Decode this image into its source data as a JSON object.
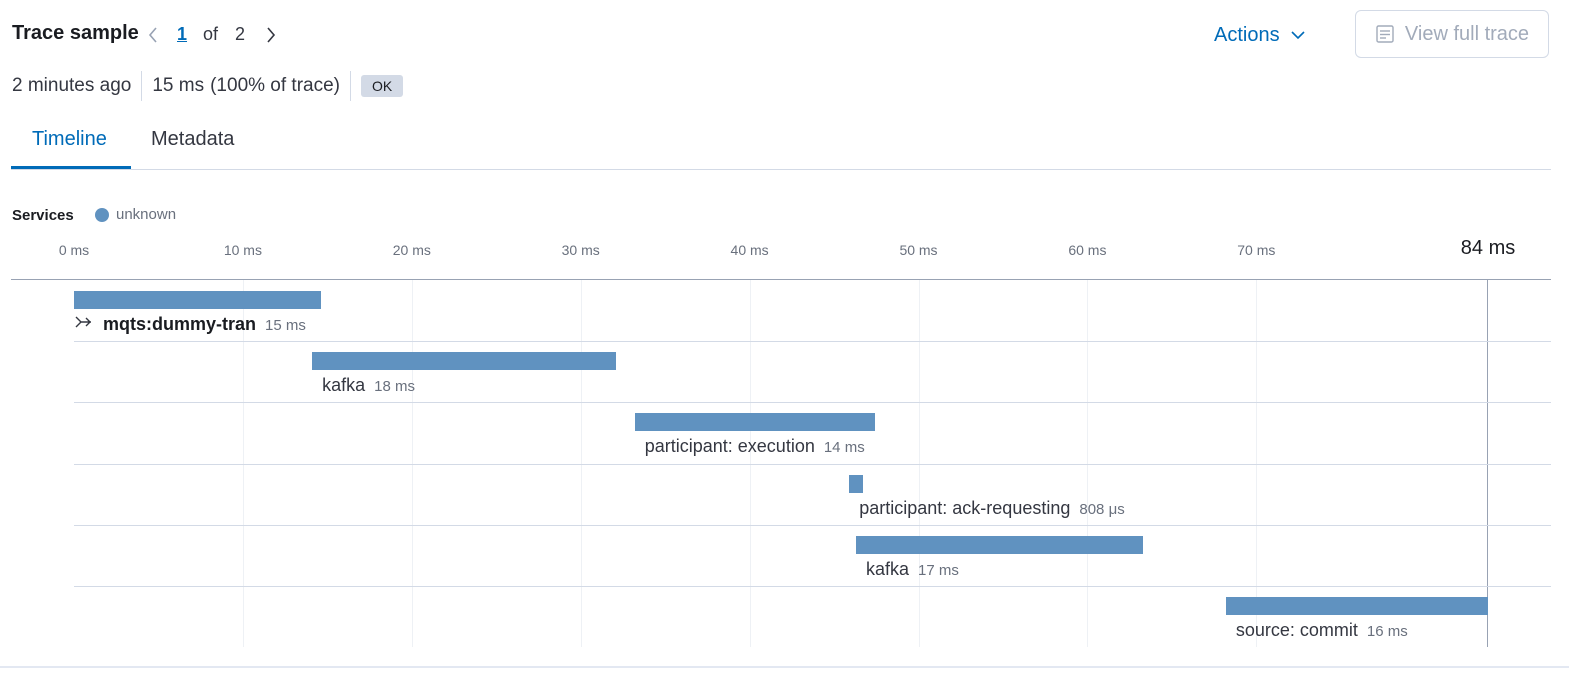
{
  "header": {
    "title": "Trace sample",
    "pager": {
      "current": "1",
      "of": "of",
      "total": "2"
    },
    "actions_label": "Actions",
    "view_full_trace_label": "View full trace"
  },
  "summary": {
    "time_ago": "2 minutes ago",
    "duration": "15 ms",
    "percent": "(100% of trace)",
    "status": "OK"
  },
  "tabs": [
    {
      "label": "Timeline",
      "active": true
    },
    {
      "label": "Metadata",
      "active": false
    }
  ],
  "legend": {
    "title": "Services",
    "items": [
      {
        "label": "unknown",
        "color": "#6092c0"
      }
    ]
  },
  "timeline": {
    "ticks": [
      "0 ms",
      "10 ms",
      "20 ms",
      "30 ms",
      "40 ms",
      "50 ms",
      "60 ms",
      "70 ms"
    ],
    "max_label": "84 ms",
    "span_color": "#6092c0",
    "spans": [
      {
        "name": "mqts:dummy-tran",
        "duration": "15 ms",
        "start_ms": 0,
        "dur_ms": 14.6,
        "transaction": true,
        "icon": "merge-icon"
      },
      {
        "name": "kafka",
        "duration": "18 ms",
        "start_ms": 14.1,
        "dur_ms": 18.0
      },
      {
        "name": "participant: execution",
        "duration": "14 ms",
        "start_ms": 33.2,
        "dur_ms": 14.2
      },
      {
        "name": "participant: ack-requesting",
        "duration": "808 μs",
        "start_ms": 45.9,
        "dur_ms": 0.8
      },
      {
        "name": "kafka",
        "duration": "17 ms",
        "start_ms": 46.3,
        "dur_ms": 17.0
      },
      {
        "name": "source: commit",
        "duration": "16 ms",
        "start_ms": 68.2,
        "dur_ms": 15.6
      }
    ]
  }
}
